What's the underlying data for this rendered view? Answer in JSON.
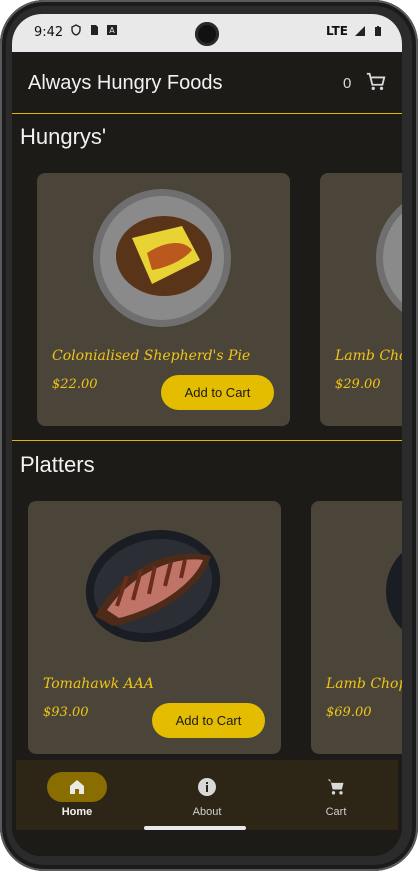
{
  "status_bar": {
    "time": "9:42",
    "icons": [
      "shield-icon",
      "sim-card-icon",
      "keyboard-a-icon"
    ],
    "network": "LTE",
    "right_icons": [
      "signal-icon",
      "battery-icon"
    ]
  },
  "app_bar": {
    "title": "Always Hungry Foods",
    "cart_count": "0",
    "cart_icon": "shopping-cart-icon"
  },
  "colors": {
    "accent": "#e5bd00",
    "background": "#1d1b17",
    "card": "#4a4538",
    "price_text": "#f0c419",
    "nav_bg": "#2d2617"
  },
  "sections": [
    {
      "title": "Hungrys'",
      "items": [
        {
          "name": "Colonialised Shepherd's Pie",
          "price": "$22.00",
          "button": "Add to Cart"
        },
        {
          "name": "Lamb Chop",
          "price": "$29.00"
        }
      ]
    },
    {
      "title": "Platters",
      "items": [
        {
          "name": "Tomahawk AAA",
          "price": "$93.00",
          "button": "Add to Cart"
        },
        {
          "name": "Lamb Chops",
          "price": "$69.00"
        }
      ]
    }
  ],
  "bottom_nav": {
    "items": [
      {
        "label": "Home",
        "icon": "home-icon",
        "selected": true
      },
      {
        "label": "About",
        "icon": "info-icon",
        "selected": false
      },
      {
        "label": "Cart",
        "icon": "cart-icon",
        "selected": false
      }
    ]
  }
}
